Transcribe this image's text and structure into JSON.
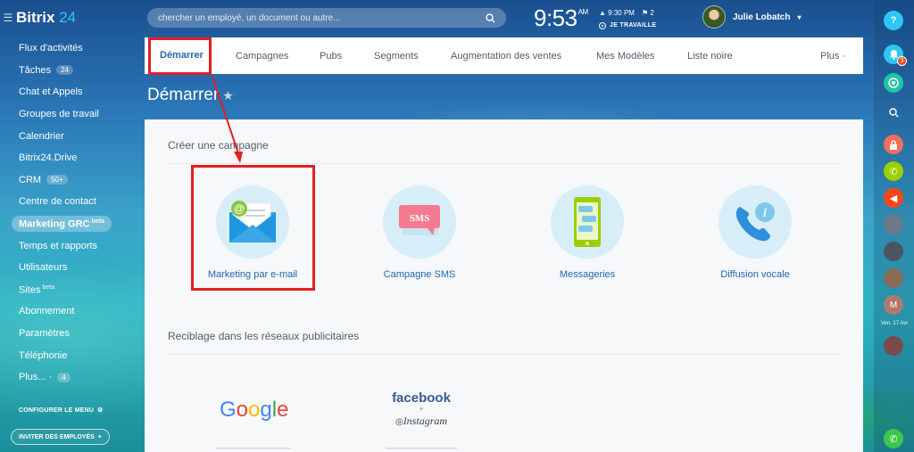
{
  "app": {
    "logo_name": "Bitrix",
    "logo_num": "24"
  },
  "sidebar": {
    "items": [
      {
        "label": "Flux d'activités"
      },
      {
        "label": "Tâches",
        "counter": "24"
      },
      {
        "label": "Chat et Appels"
      },
      {
        "label": "Groupes de travail"
      },
      {
        "label": "Calendrier"
      },
      {
        "label": "Bitrix24.Drive"
      },
      {
        "label": "CRM",
        "counter": "50+"
      },
      {
        "label": "Centre de contact"
      },
      {
        "label": "Marketing GRC",
        "sup": "beta",
        "active": true
      },
      {
        "label": "Temps et rapports"
      },
      {
        "label": "Utilisateurs"
      },
      {
        "label": "Sites",
        "sup": "beta"
      },
      {
        "label": "Abonnement"
      },
      {
        "label": "Paramètres"
      },
      {
        "label": "Téléphonie"
      },
      {
        "label": "Plus... ·",
        "counter": "4"
      }
    ],
    "config_menu": "CONFIGURER LE MENU",
    "invite": "INVITER DES EMPLOYÉS"
  },
  "topbar": {
    "search_placeholder": "chercher un employé, un document ou autre...",
    "time": "9:53",
    "ampm": "AM",
    "alarm": "9:30 PM",
    "flag_count": "2",
    "status": "JE TRAVAILLE",
    "user_name": "Julie Lobatch"
  },
  "rightbar": {
    "help": "?",
    "notif_count": "3",
    "date": "Ven. 17 Avr"
  },
  "tabs": [
    {
      "label": "Démarrer",
      "active": true
    },
    {
      "label": "Campagnes"
    },
    {
      "label": "Pubs"
    },
    {
      "label": "Segments"
    },
    {
      "label": "Augmentation des ventes"
    },
    {
      "label": "Mes Modèles"
    },
    {
      "label": "Liste noire"
    },
    {
      "label": "Plus ·"
    }
  ],
  "page": {
    "title": "Démarrer",
    "section_campaign": "Créer une campagne",
    "tiles": [
      {
        "label": "Marketing par e-mail",
        "icon": "email-icon"
      },
      {
        "label": "Campagne SMS",
        "icon": "sms-icon",
        "icon_text": "SMS"
      },
      {
        "label": "Messageries",
        "icon": "messenger-icon"
      },
      {
        "label": "Diffusion vocale",
        "icon": "phone-info-icon"
      }
    ],
    "section_retargeting": "Reciblage dans les réseaux publicitaires",
    "ads": {
      "google": "Google",
      "facebook": "facebook",
      "plus": "+",
      "instagram": "Instagram"
    }
  },
  "colors": {
    "accent": "#2067b0",
    "highlight": "#e31e24",
    "tile_bg": "#d7eef8"
  }
}
